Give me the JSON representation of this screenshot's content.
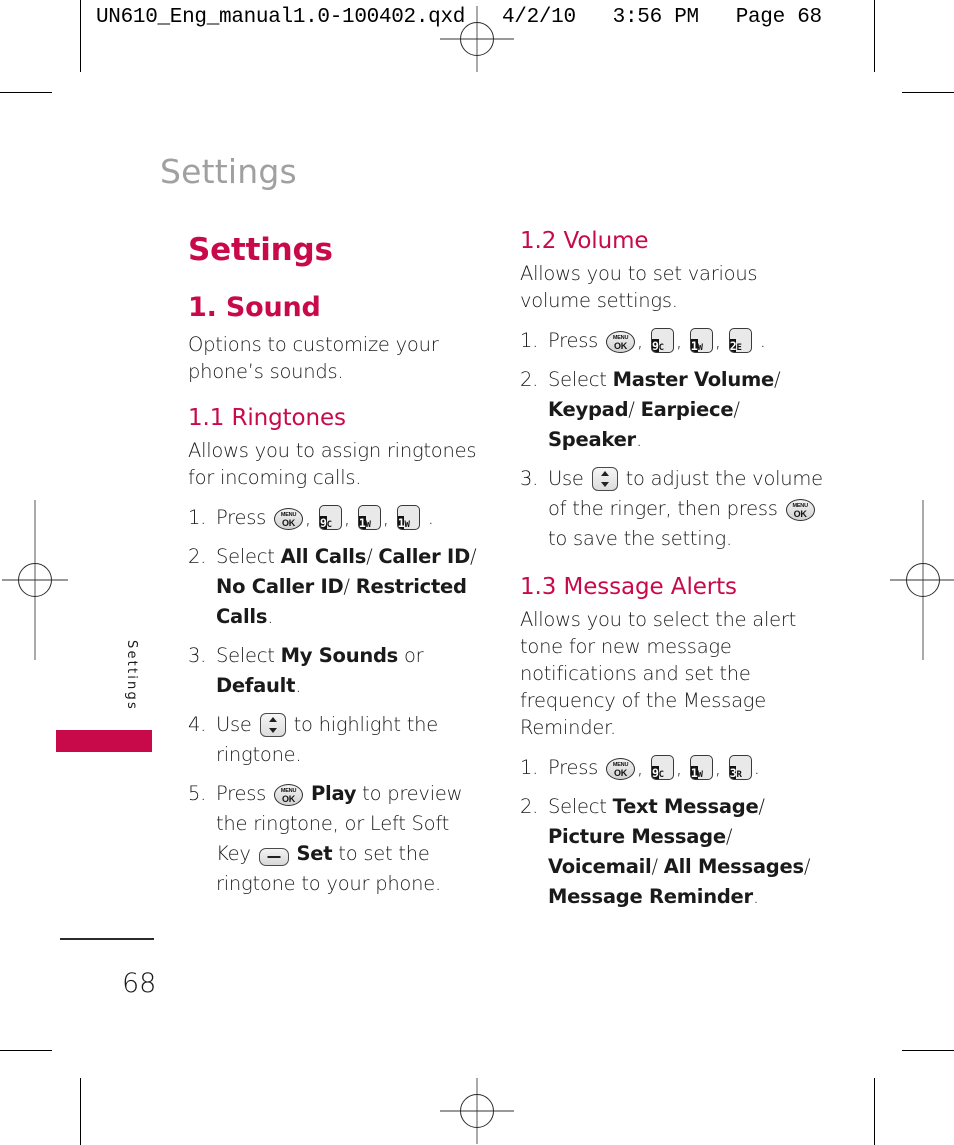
{
  "proof": {
    "header": "UN610_Eng_manual1.0-100402.qxd   4/2/10   3:56 PM   Page 68"
  },
  "running_head": "Settings",
  "side_tab": {
    "label": "Settings",
    "color": "#c80a4b"
  },
  "footer": {
    "page_number": "68"
  },
  "accent_color": "#c80a4b",
  "left_column": {
    "doc_title": "Settings",
    "section": {
      "heading": "1. Sound",
      "intro": "Options to customize your phone’s sounds."
    },
    "subsection": {
      "heading": "1.1 Ringtones",
      "intro": "Allows you to assign ringtones for incoming calls.",
      "steps": [
        {
          "num": "1.",
          "parts": [
            {
              "type": "text",
              "value": "Press "
            },
            {
              "type": "key-menuok"
            },
            {
              "type": "text",
              "value": ", "
            },
            {
              "type": "key-cap",
              "digit": "9",
              "letter": "C"
            },
            {
              "type": "text",
              "value": ", "
            },
            {
              "type": "key-cap",
              "digit": "1",
              "letter": "W"
            },
            {
              "type": "text",
              "value": ", "
            },
            {
              "type": "key-cap",
              "digit": "1",
              "letter": "W"
            },
            {
              "type": "text",
              "value": " ."
            }
          ]
        },
        {
          "num": "2.",
          "parts": [
            {
              "type": "text",
              "value": "Select "
            },
            {
              "type": "bold",
              "value": "All Calls"
            },
            {
              "type": "text",
              "value": "/ "
            },
            {
              "type": "bold",
              "value": "Caller ID"
            },
            {
              "type": "text",
              "value": "/ "
            },
            {
              "type": "bold",
              "value": "No Caller ID"
            },
            {
              "type": "text",
              "value": "/ "
            },
            {
              "type": "bold",
              "value": "Restricted Calls"
            },
            {
              "type": "text",
              "value": "."
            }
          ]
        },
        {
          "num": "3.",
          "parts": [
            {
              "type": "text",
              "value": "Select "
            },
            {
              "type": "bold",
              "value": "My Sounds"
            },
            {
              "type": "text",
              "value": " or "
            },
            {
              "type": "bold",
              "value": "Default"
            },
            {
              "type": "text",
              "value": "."
            }
          ]
        },
        {
          "num": "4.",
          "parts": [
            {
              "type": "text",
              "value": "Use "
            },
            {
              "type": "key-nav"
            },
            {
              "type": "text",
              "value": " to highlight the ringtone."
            }
          ]
        },
        {
          "num": "5.",
          "parts": [
            {
              "type": "text",
              "value": "Press "
            },
            {
              "type": "key-menuok"
            },
            {
              "type": "text",
              "value": " "
            },
            {
              "type": "bold",
              "value": "Play"
            },
            {
              "type": "text",
              "value": " to preview the ringtone, or Left Soft Key "
            },
            {
              "type": "key-soft"
            },
            {
              "type": "text",
              "value": " "
            },
            {
              "type": "bold",
              "value": "Set"
            },
            {
              "type": "text",
              "value": " to set the ringtone to your phone."
            }
          ]
        }
      ]
    }
  },
  "right_column": {
    "subsections": [
      {
        "heading": "1.2 Volume",
        "intro": "Allows you to set various volume settings.",
        "steps": [
          {
            "num": "1.",
            "parts": [
              {
                "type": "text",
                "value": "Press "
              },
              {
                "type": "key-menuok"
              },
              {
                "type": "text",
                "value": ", "
              },
              {
                "type": "key-cap",
                "digit": "9",
                "letter": "C"
              },
              {
                "type": "text",
                "value": ", "
              },
              {
                "type": "key-cap",
                "digit": "1",
                "letter": "W"
              },
              {
                "type": "text",
                "value": ", "
              },
              {
                "type": "key-cap",
                "digit": "2",
                "letter": "E"
              },
              {
                "type": "text",
                "value": " ."
              }
            ]
          },
          {
            "num": "2.",
            "parts": [
              {
                "type": "text",
                "value": "Select "
              },
              {
                "type": "bold",
                "value": "Master Volume"
              },
              {
                "type": "text",
                "value": "/ "
              },
              {
                "type": "bold",
                "value": "Keypad"
              },
              {
                "type": "text",
                "value": "/ "
              },
              {
                "type": "bold",
                "value": "Earpiece"
              },
              {
                "type": "text",
                "value": "/ "
              },
              {
                "type": "bold",
                "value": "Speaker"
              },
              {
                "type": "text",
                "value": "."
              }
            ]
          },
          {
            "num": "3.",
            "parts": [
              {
                "type": "text",
                "value": "Use "
              },
              {
                "type": "key-nav"
              },
              {
                "type": "text",
                "value": " to adjust the volume of the ringer, then press "
              },
              {
                "type": "key-menuok"
              },
              {
                "type": "text",
                "value": " to save the setting."
              }
            ]
          }
        ]
      },
      {
        "heading": "1.3 Message Alerts",
        "intro": "Allows you to select the alert tone for new message notifications and set the frequency of the Message Reminder.",
        "steps": [
          {
            "num": "1.",
            "parts": [
              {
                "type": "text",
                "value": "Press "
              },
              {
                "type": "key-menuok"
              },
              {
                "type": "text",
                "value": ", "
              },
              {
                "type": "key-cap",
                "digit": "9",
                "letter": "C"
              },
              {
                "type": "text",
                "value": ", "
              },
              {
                "type": "key-cap",
                "digit": "1",
                "letter": "W"
              },
              {
                "type": "text",
                "value": ", "
              },
              {
                "type": "key-cap",
                "digit": "3",
                "letter": "R"
              },
              {
                "type": "text",
                "value": "."
              }
            ]
          },
          {
            "num": "2.",
            "parts": [
              {
                "type": "text",
                "value": "Select "
              },
              {
                "type": "bold",
                "value": "Text Message"
              },
              {
                "type": "text",
                "value": "/ "
              },
              {
                "type": "bold",
                "value": "Picture Message"
              },
              {
                "type": "text",
                "value": "/ "
              },
              {
                "type": "bold",
                "value": "Voicemail"
              },
              {
                "type": "text",
                "value": "/ "
              },
              {
                "type": "bold",
                "value": "All Messages"
              },
              {
                "type": "text",
                "value": "/ "
              },
              {
                "type": "bold",
                "value": "Message Reminder"
              },
              {
                "type": "text",
                "value": "."
              }
            ]
          }
        ]
      }
    ]
  }
}
